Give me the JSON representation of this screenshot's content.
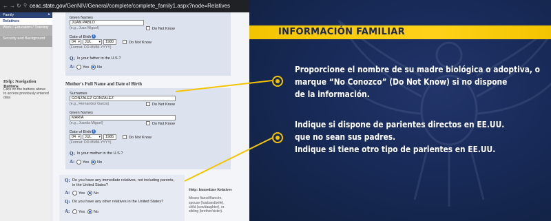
{
  "browser": {
    "url_domain": "ceac.state.gov",
    "url_path": "/GenNIV/General/complete/complete_family1.aspx?node=Relatives"
  },
  "sidebar": {
    "items": [
      {
        "label": "Family"
      },
      {
        "label": "Relatives"
      },
      {
        "label": "Work / Education / Training"
      },
      {
        "label": "Security and Background"
      }
    ],
    "help_title": "Help: Navigation Buttons",
    "help_text": "Click on the buttons above to access previously entered data"
  },
  "father": {
    "given_names_label": "Given Names",
    "given_names_value": "JUAN PABLO",
    "given_names_hint": "(e.g., Juan Miguel)",
    "do_not_know": "Do Not Know",
    "dob_label": "Date of Birth",
    "dob_day": "04",
    "dob_month": "JUL",
    "dob_year": "1980",
    "dob_hint": "(Format: DD-MMM-YYYY)",
    "in_us_question": "Is your father in the U.S.?",
    "yes": "Yes",
    "no": "No"
  },
  "mother": {
    "section_title": "Mother's Full Name and Date of Birth",
    "surnames_label": "Surnames",
    "surnames_value": "GONZALEZ GONZALEZ",
    "surnames_hint": "(e.g., Hernandez Garcia)",
    "given_names_label": "Given Names",
    "given_names_value": "MARIA",
    "given_names_hint": "(e.g., Juanita Miguel)",
    "do_not_know": "Do Not Know",
    "dob_label": "Date of Birth",
    "dob_day": "04",
    "dob_month": "JUL",
    "dob_year": "1985",
    "dob_hint": "(Format: DD-MMM-YYYY)",
    "in_us_question": "Is your mother in the U.S.?",
    "yes": "Yes",
    "no": "No"
  },
  "relatives": {
    "q_label": "Q:",
    "a_label": "A:",
    "immediate_question_line1": "Do you have any immediate relatives, not including parents,",
    "immediate_question_line2": "in the United States?",
    "other_question": "Do you have any other relatives in the United States?",
    "yes": "Yes",
    "no": "No",
    "help_title": "Help: Immediate Relatives",
    "help_text_1": "Means fiancé/fiancée,",
    "help_text_2": "spouse (husband/wife),",
    "help_text_3": "child (son/daughter), or",
    "help_text_4": "sibling (brother/sister)."
  },
  "infographic": {
    "title": "INFORMACIÓN FAMILIAR",
    "note1_line1": "Proporcione el nombre de su madre biológica o adoptiva, o",
    "note1_line2": "marque “No Conozco” (Do Not Know) si no dispone",
    "note1_line3": "de la información.",
    "note2_line1": "Indique si dispone de parientes directos en EE.UU.",
    "note2_line2": "que no sean sus padres.",
    "note2_line3": "Indique si tiene otro tipo de parientes en EE.UU.",
    "accent_color": "#f5c400",
    "background_color": "#182a58"
  }
}
